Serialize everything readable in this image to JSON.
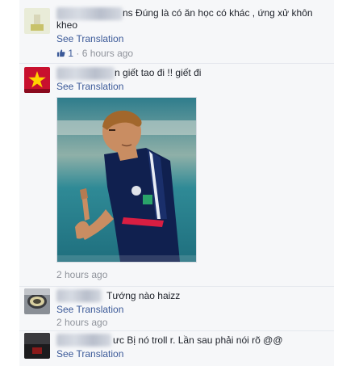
{
  "comments": [
    {
      "name_suffix": "ns",
      "text_line1": "Đúng là có ăn học có khác , ứng xử khôn",
      "text_line2": "kheo",
      "translate": "See Translation",
      "likes": "1",
      "time": "· 6 hours ago"
    },
    {
      "name_suffix": "n",
      "text": "giết tao đi !! giết đi",
      "translate": "See Translation",
      "time": "2 hours ago"
    },
    {
      "text": "Tướng nào haizz",
      "translate": "See Translation",
      "time": "2 hours ago"
    },
    {
      "name_suffix": "ưc",
      "text": "Bị nó troll r. Lần sau phải nói rõ @@",
      "translate": "See Translation"
    }
  ],
  "icons": {
    "like": "thumbs-up-icon"
  },
  "colors": {
    "link": "#3b5998",
    "meta": "#90949c",
    "panel": "#f6f7f9"
  }
}
